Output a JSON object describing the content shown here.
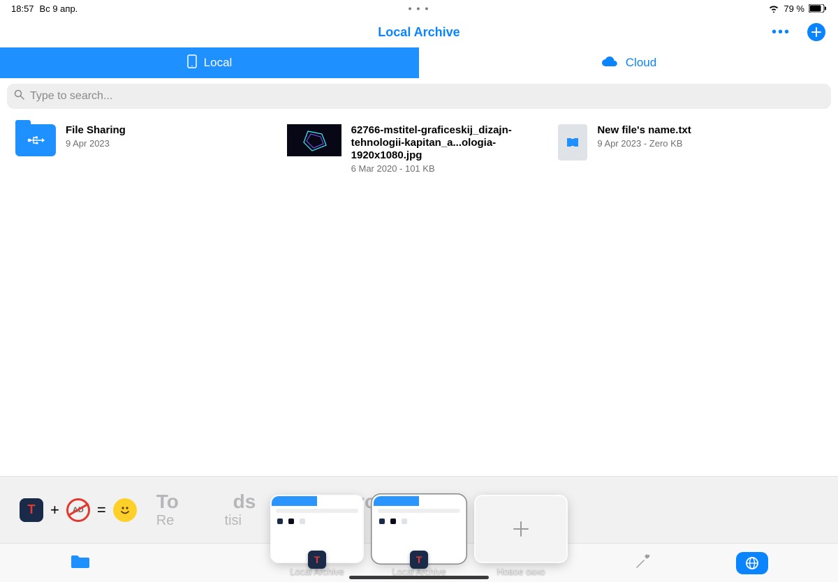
{
  "statusbar": {
    "time": "18:57",
    "date": "Вс 9 апр.",
    "battery": "79 %"
  },
  "nav": {
    "title": "Local Archive",
    "more": "•••",
    "add": "+"
  },
  "tabs": {
    "local": "Local",
    "cloud": "Cloud"
  },
  "search": {
    "placeholder": "Type to search..."
  },
  "files": [
    {
      "name": "File Sharing",
      "sub": "9 Apr 2023",
      "kind": "folder"
    },
    {
      "name": "62766-mstitel-graficeskij_dizajn-tehnologii-kapitan_a...ologia-1920x1080.jpg",
      "sub": "6 Mar 2020 - 101 KB",
      "kind": "image"
    },
    {
      "name": "New file's name.txt",
      "sub": "9 Apr 2023 - Zero KB",
      "kind": "doc"
    }
  ],
  "ad": {
    "plus": "+",
    "eq": "=",
    "noad_text": "AD",
    "line1": "To",
    "line1b": "ds",
    "line1c": "you",
    "line2a": "Re",
    "line2b": "tisi"
  },
  "switcher": {
    "items": [
      {
        "label": "Local Archive"
      },
      {
        "label": "Local Archive"
      },
      {
        "label": "Новое окно"
      }
    ]
  }
}
